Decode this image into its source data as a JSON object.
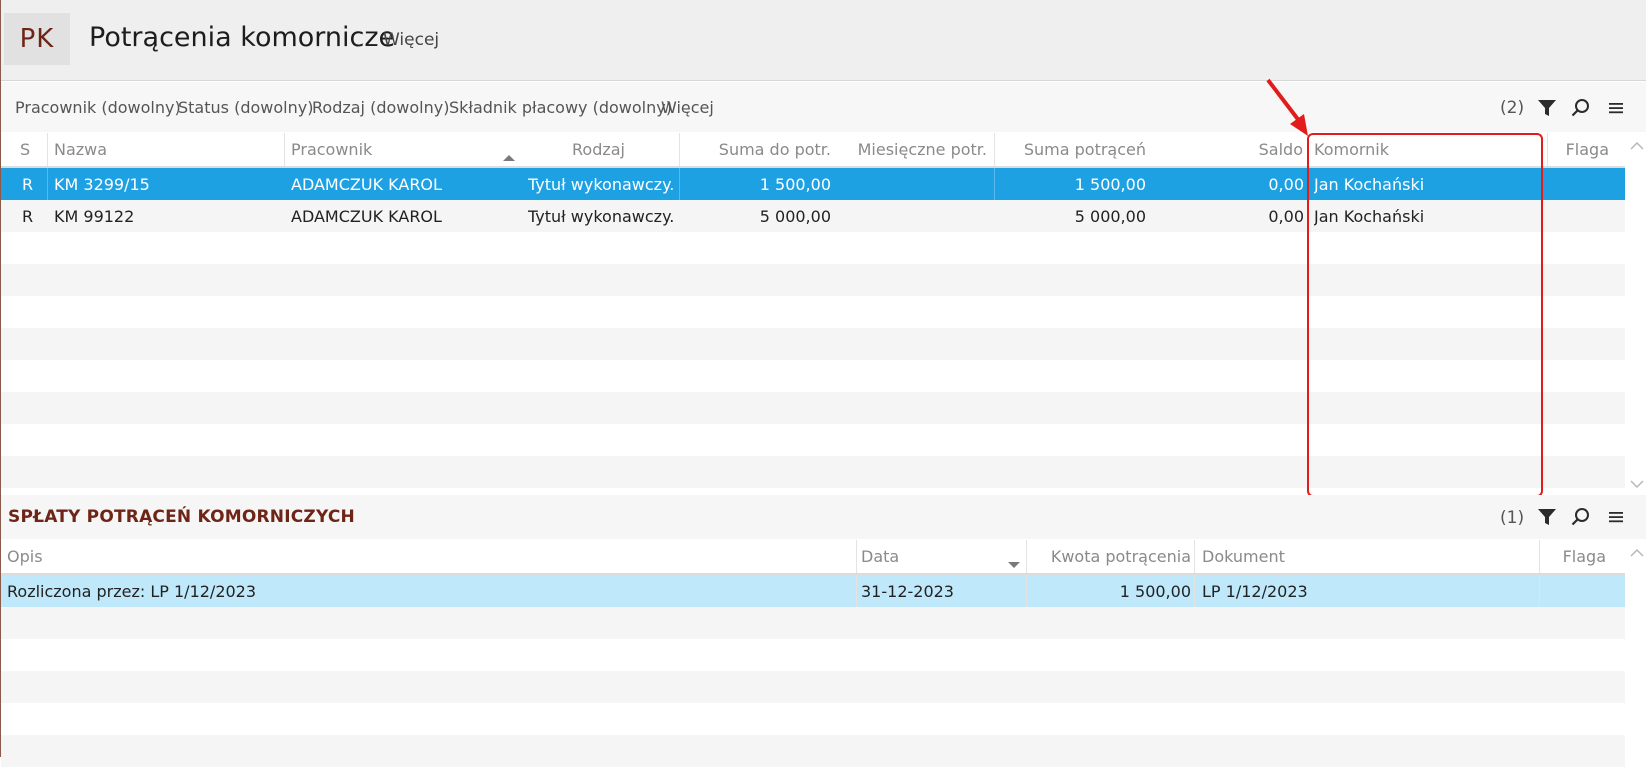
{
  "header": {
    "badge": "PK",
    "title": "Potrącenia komornicze",
    "more": "Więcej"
  },
  "filters": {
    "items": [
      "Pracownik (dowolny)",
      "Status (dowolny)",
      "Rodzaj (dowolny)",
      "Składnik płacowy (dowolny)",
      "Więcej"
    ],
    "count": "(2)"
  },
  "main_grid": {
    "columns": [
      "S",
      "Nazwa",
      "Pracownik",
      "Rodzaj",
      "Suma do potr.",
      "Miesięczne potr.",
      "Suma potrąceń",
      "Saldo",
      "Komornik",
      "Flaga"
    ],
    "rows": [
      {
        "s": "R",
        "nazwa": "KM 3299/15",
        "pracownik": "ADAMCZUK KAROL",
        "rodzaj": "Tytuł wykonawczy...",
        "suma_do": "1 500,00",
        "miesieczne": "",
        "suma_potr": "1 500,00",
        "saldo": "0,00",
        "komornik": "Jan Kochański",
        "flaga": ""
      },
      {
        "s": "R",
        "nazwa": "KM 99122",
        "pracownik": "ADAMCZUK KAROL",
        "rodzaj": "Tytuł wykonawczy...",
        "suma_do": "5 000,00",
        "miesieczne": "",
        "suma_potr": "5 000,00",
        "saldo": "0,00",
        "komornik": "Jan Kochański",
        "flaga": ""
      }
    ]
  },
  "detail": {
    "title": "SPŁATY POTRĄCEŃ KOMORNICZYCH",
    "count": "(1)",
    "columns": [
      "Opis",
      "Data",
      "Kwota potrącenia",
      "Dokument",
      "Flaga"
    ],
    "rows": [
      {
        "opis": "Rozliczona przez: LP 1/12/2023",
        "data": "31-12-2023",
        "kwota": "1 500,00",
        "dokument": "LP 1/12/2023",
        "flaga": ""
      }
    ]
  },
  "colors": {
    "accent": "#6e2416",
    "selection": "#1ea1e3",
    "selection_light": "#bfe8fa",
    "annotation": "#e21b1b"
  },
  "icons": [
    "filter-icon",
    "search-icon",
    "menu-icon",
    "sort-ascending-icon",
    "sort-descending-icon",
    "scroll-up-icon",
    "scroll-down-icon",
    "annotation-arrow-icon"
  ]
}
